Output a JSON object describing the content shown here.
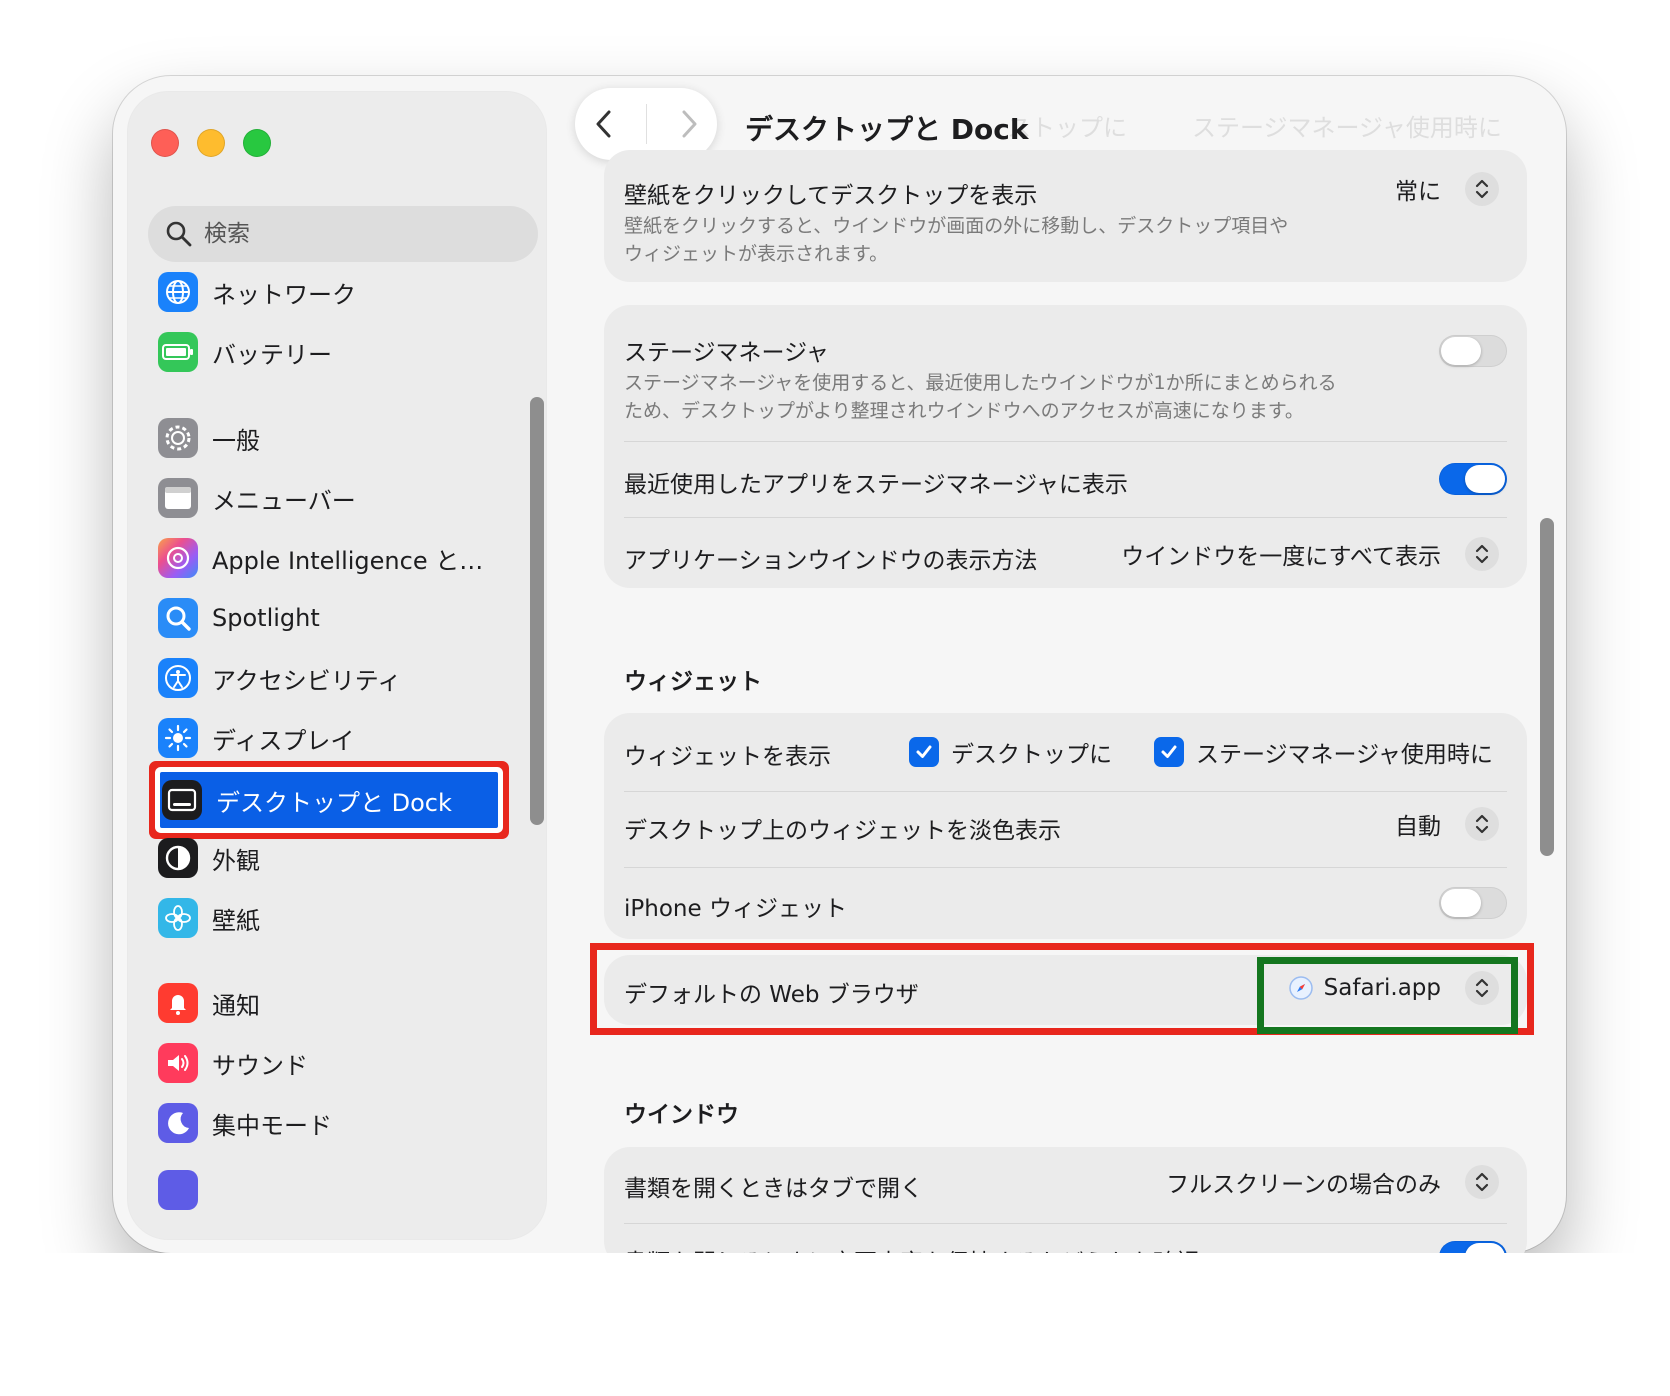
{
  "sidebar": {
    "search_placeholder": "検索",
    "items": [
      {
        "label": "ネットワーク",
        "icon": "globe-icon"
      },
      {
        "label": "バッテリー",
        "icon": "battery-icon"
      },
      {
        "label": "一般",
        "icon": "gear-icon"
      },
      {
        "label": "メニューバー",
        "icon": "menubar-icon"
      },
      {
        "label": "Apple Intelligence と…",
        "icon": "apple-intelligence-icon"
      },
      {
        "label": "Spotlight",
        "icon": "magnifier-icon"
      },
      {
        "label": "アクセシビリティ",
        "icon": "accessibility-icon"
      },
      {
        "label": "ディスプレイ",
        "icon": "sun-icon"
      },
      {
        "label": "デスクトップと Dock",
        "icon": "dock-icon"
      },
      {
        "label": "外観",
        "icon": "appearance-icon"
      },
      {
        "label": "壁紙",
        "icon": "flower-icon"
      },
      {
        "label": "通知",
        "icon": "bell-icon"
      },
      {
        "label": "サウンド",
        "icon": "speaker-icon"
      },
      {
        "label": "集中モード",
        "icon": "moon-icon"
      }
    ]
  },
  "header": {
    "title": "デスクトップと Dock",
    "ghost_left": "ストップに",
    "ghost_right": "ステージマネージャ使用時に"
  },
  "click_wallpaper": {
    "title": "壁紙をクリックしてデスクトップを表示",
    "desc_line1": "壁紙をクリックすると、ウインドウが画面の外に移動し、デスクトップ項目や",
    "desc_line2": "ウィジェットが表示されます。",
    "value": "常に"
  },
  "stage_manager": {
    "title": "ステージマネージャ",
    "desc_line1": "ステージマネージャを使用すると、最近使用したウインドウが1か所にまとめられる",
    "desc_line2": "ため、デスクトップがより整理されウインドウへのアクセスが高速になります。",
    "enabled": false,
    "recent_apps_label": "最近使用したアプリをステージマネージャに表示",
    "recent_apps_enabled": true,
    "app_windows_label": "アプリケーションウインドウの表示方法",
    "app_windows_value": "ウインドウを一度にすべて表示"
  },
  "widgets": {
    "header": "ウィジェット",
    "show_label": "ウィジェットを表示",
    "on_desktop_label": "デスクトップに",
    "on_desktop_checked": true,
    "in_stage_label": "ステージマネージャ使用時に",
    "in_stage_checked": true,
    "dim_label": "デスクトップ上のウィジェットを淡色表示",
    "dim_value": "自動",
    "iphone_label": "iPhone ウィジェット",
    "iphone_enabled": false
  },
  "default_browser": {
    "label": "デフォルトの Web ブラウザ",
    "value": "Safari.app"
  },
  "windows": {
    "header": "ウインドウ",
    "tabs_label": "書類を開くときはタブで開く",
    "tabs_value": "フルスクリーンの場合のみ",
    "ask_keep_label": "書類を閉じるときに変更内容を保持するかどうかを確認"
  },
  "colors": {
    "accent": "#0a68ea",
    "selection": "#0a5fe6",
    "highlight_red": "#e8271d",
    "highlight_green": "#14761f"
  }
}
